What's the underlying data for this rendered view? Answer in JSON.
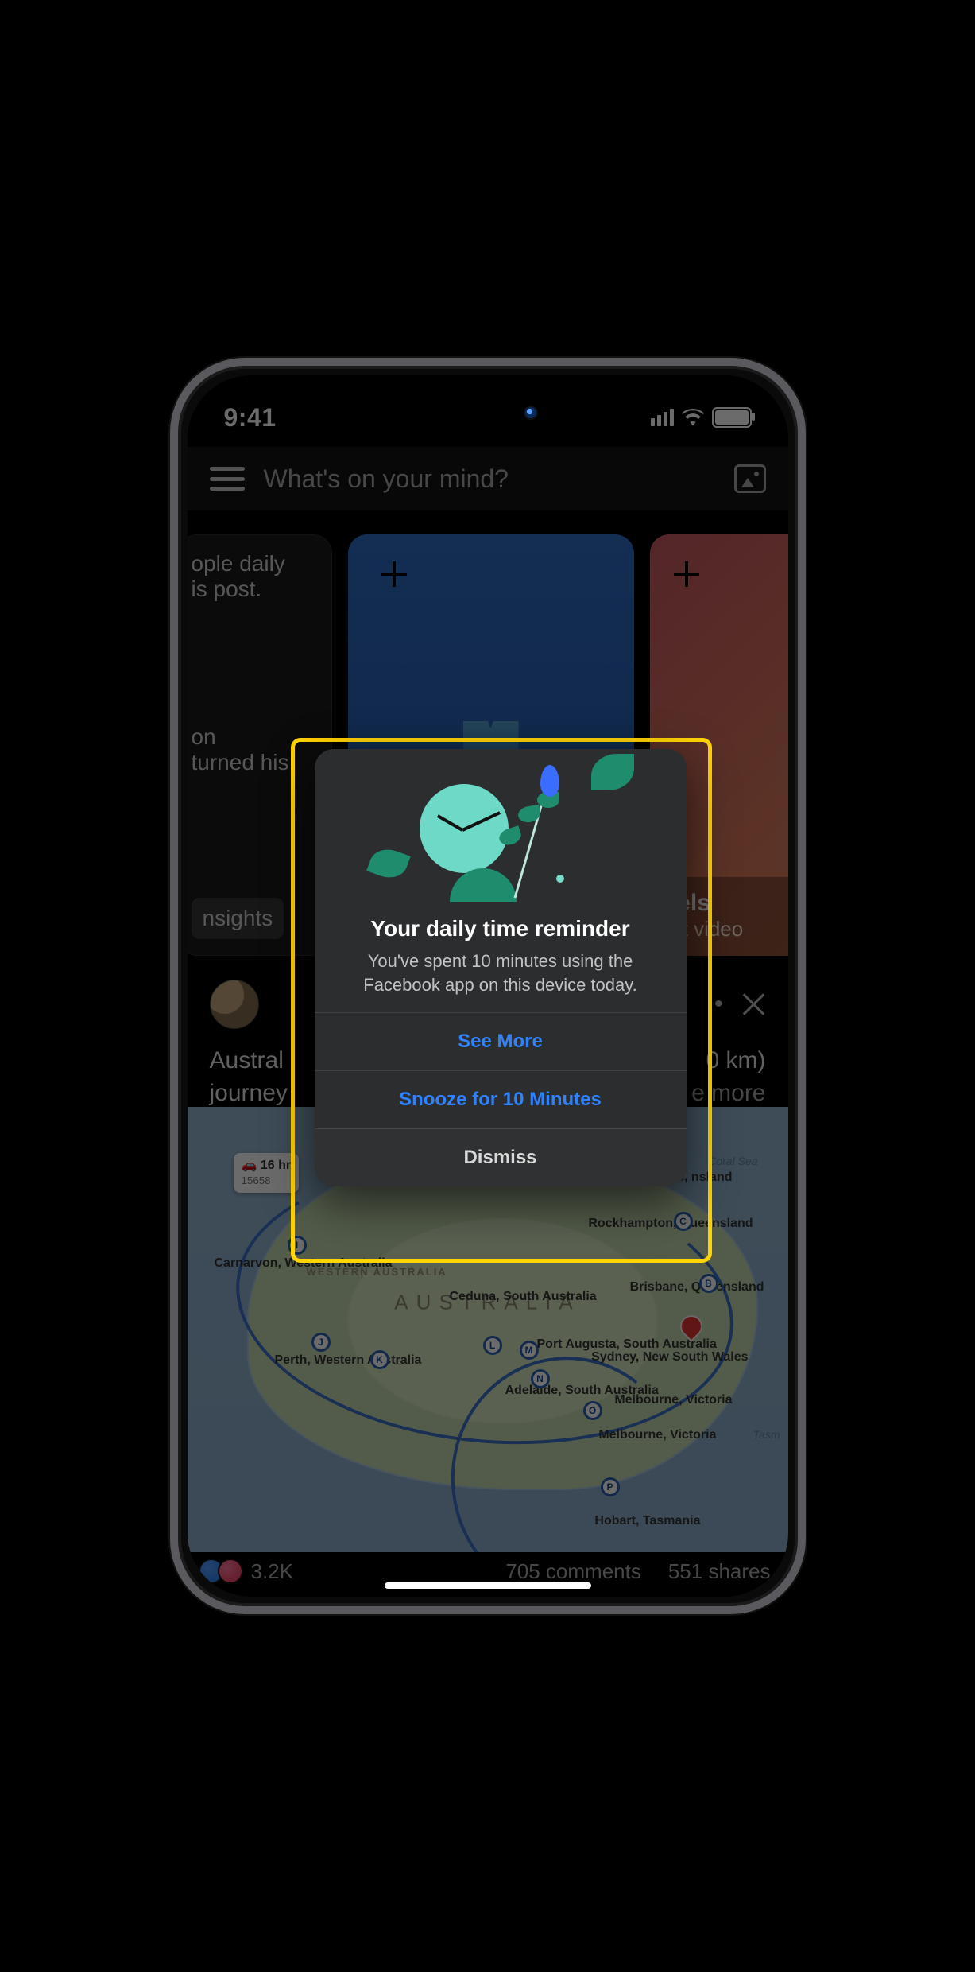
{
  "status": {
    "time": "9:41"
  },
  "composer": {
    "placeholder": "What's on your mind?"
  },
  "stories": {
    "left_text_top": "ople daily",
    "left_text_top2": "is post.",
    "left_text_mid": "on",
    "left_text_mid2": "turned his",
    "insights_label": "nsights",
    "reels_title": "eels",
    "reels_sub": "ort video"
  },
  "post": {
    "caption_left_1": "Austral",
    "caption_left_2": "journey",
    "caption_right_1": "0 km)",
    "caption_right_2": "e more"
  },
  "map": {
    "country": "AUSTRALIA",
    "trip_hours": "16 hr",
    "trip_km": "15658",
    "sea": "Coral Sea",
    "labels": {
      "townsville": "nsville, nsland",
      "rockhampton": "Rockhampton, Queensland",
      "brisbane": "Brisbane, Queensland",
      "sydney": "Sydney, New South Wales",
      "melbourne": "Melbourne, Victoria",
      "melbourne2": "Melbourne, Victoria",
      "hobart": "Hobart, Tasmania",
      "adelaide": "Adelaide, South Australia",
      "port_augusta": "Port Augusta, South Australia",
      "ceduna": "Ceduna, South Australia",
      "perth": "Perth, Western Australia",
      "carnarvon": "Carnarvon, Western Australia",
      "wa": "WESTERN AUSTRALIA",
      "tas_sea": "Tasm"
    }
  },
  "engage": {
    "count": "3.2K",
    "comments": "705 comments",
    "shares": "551 shares"
  },
  "modal": {
    "title": "Your daily time reminder",
    "body": "You've spent 10 minutes using the Facebook app on this device today.",
    "see_more": "See More",
    "snooze": "Snooze for 10 Minutes",
    "dismiss": "Dismiss"
  }
}
